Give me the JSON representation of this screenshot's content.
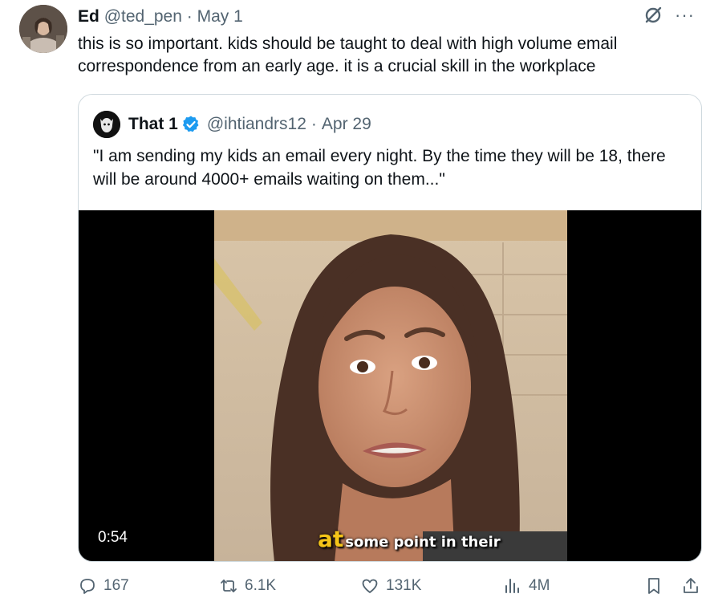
{
  "tweet": {
    "author_name": "Ed",
    "author_handle": "@ted_pen",
    "separator": "·",
    "date": "May 1",
    "text": "this is so important. kids should be taught to deal with high volume email correspondence from an early age. it is a crucial skill in the workplace",
    "more_label": "···",
    "icons": {
      "avatar": "avatar-photo",
      "grok": "grok-icon",
      "more": "more-icon"
    }
  },
  "quote": {
    "author_name": "That 1",
    "author_handle": "@ihtiandrs12",
    "separator": "·",
    "date": "Apr 29",
    "text": "\"I am sending my kids an email every night. By the time they will be 18, there will be around 4000+ emails waiting on them...\"",
    "verified_color": "#1d9bf0",
    "video": {
      "duration": "0:54",
      "caption_accent": "at",
      "caption_rest": "some point in their",
      "caption_accent_color": "#f5c518"
    }
  },
  "actions": {
    "replies": "167",
    "reposts": "6.1K",
    "likes": "131K",
    "views": "4M",
    "icons": [
      "reply-icon",
      "repost-icon",
      "like-icon",
      "views-icon",
      "bookmark-icon",
      "share-icon"
    ]
  },
  "colors": {
    "text_primary": "#0f1419",
    "text_secondary": "#536471",
    "border": "#cfd9de",
    "accent": "#1d9bf0"
  }
}
